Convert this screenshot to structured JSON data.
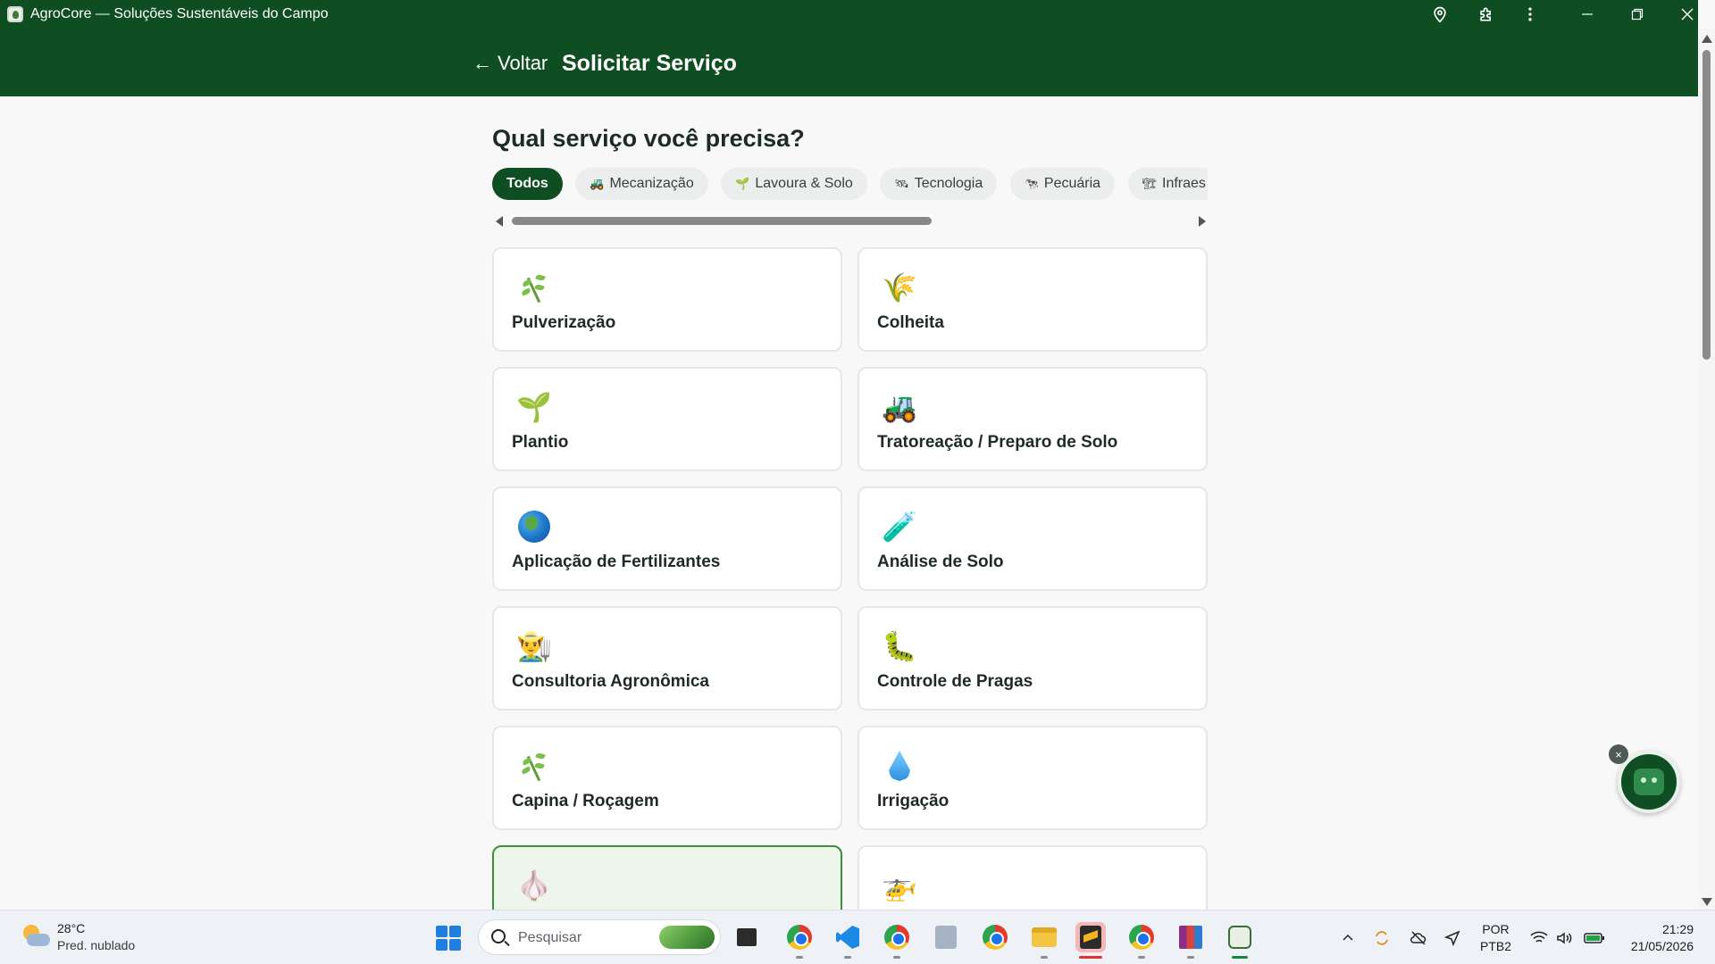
{
  "window": {
    "title": "AgroCore — Soluções Sustentáveis do Campo",
    "icons": [
      "location-pin-icon",
      "extensions-puzzle-icon",
      "more-vertical-icon"
    ],
    "controls": [
      "minimize-icon",
      "restore-icon",
      "close-icon"
    ]
  },
  "header": {
    "back_arrow": "←",
    "back_label": "Voltar",
    "title": "Solicitar Serviço"
  },
  "main": {
    "heading": "Qual serviço você precisa?",
    "categories": [
      {
        "label": "Todos",
        "icon": "",
        "active": true
      },
      {
        "label": "Mecanização",
        "icon": "tractor-icon",
        "glyph": "🚜"
      },
      {
        "label": "Lavoura & Solo",
        "icon": "seedling-icon",
        "glyph": "🌱"
      },
      {
        "label": "Tecnologia",
        "icon": "satellite-icon",
        "glyph": "🛰"
      },
      {
        "label": "Pecuária",
        "icon": "cow-icon",
        "glyph": "🐄"
      },
      {
        "label": "Infraes",
        "icon": "construction-icon",
        "glyph": "🏗"
      }
    ],
    "services": [
      {
        "label": "Pulverização",
        "icon": "herb-icon"
      },
      {
        "label": "Colheita",
        "icon": "wheat-icon",
        "glyph": "🌾"
      },
      {
        "label": "Plantio",
        "icon": "sprout-icon",
        "glyph": "🌱"
      },
      {
        "label": "Tratoreação / Preparo de Solo",
        "icon": "tractor-icon",
        "glyph": "🚜"
      },
      {
        "label": "Aplicação de Fertilizantes",
        "icon": "globe-icon"
      },
      {
        "label": "Análise de Solo",
        "icon": "test-tube-icon",
        "glyph": "🧪"
      },
      {
        "label": "Consultoria Agronômica",
        "icon": "farmer-icon",
        "glyph": "👨‍🌾"
      },
      {
        "label": "Controle de Pragas",
        "icon": "bug-icon",
        "glyph": "🐛"
      },
      {
        "label": "Capina / Roçagem",
        "icon": "herb-icon"
      },
      {
        "label": "Irrigação",
        "icon": "droplet-icon"
      },
      {
        "label": "",
        "icon": "garlic-icon",
        "glyph": "🧄",
        "highlight": true
      },
      {
        "label": "",
        "icon": "helicopter-icon",
        "glyph": "🚁"
      }
    ]
  },
  "chatbot": {
    "close": "×",
    "icon": "robot-icon"
  },
  "taskbar": {
    "weather": {
      "temp": "28°C",
      "desc": "Pred. nublado",
      "icon": "partly-cloudy-icon"
    },
    "search_placeholder": "Pesquisar",
    "lang_1": "POR",
    "lang_2": "PTB2",
    "time": "21:29",
    "date": "21/05/2026"
  },
  "colors": {
    "brand_green": "#0f4d22",
    "page_bg": "#f7f8f7",
    "highlight_border": "#3c8f3c"
  }
}
